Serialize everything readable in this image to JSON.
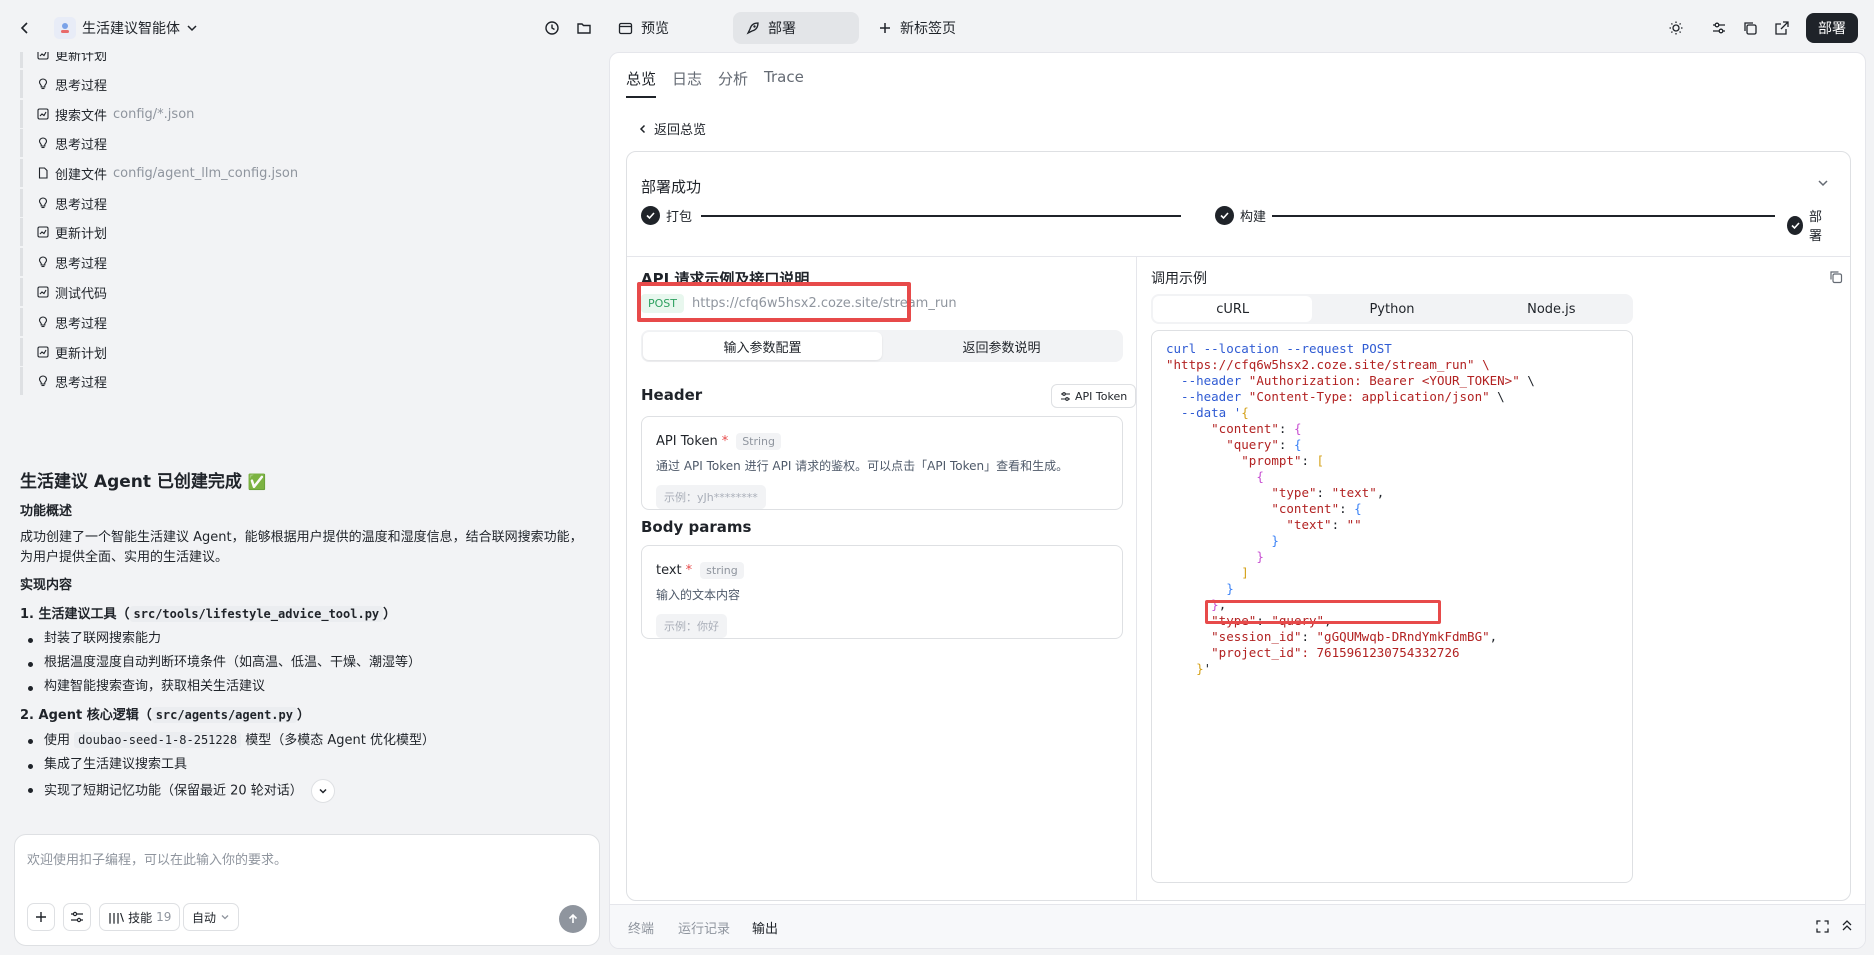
{
  "topbar": {
    "project_name": "生活建议智能体",
    "tab_preview": "预览",
    "tab_deploy": "部署",
    "tab_new": "新标签页",
    "deploy_button": "部署"
  },
  "left": {
    "steps": [
      {
        "label": "更新计划",
        "sub": "",
        "icon": "plan-icon"
      },
      {
        "label": "思考过程",
        "sub": "",
        "icon": "bulb-icon"
      },
      {
        "label": "搜索文件",
        "sub": "config/*.json",
        "icon": "plan-icon"
      },
      {
        "label": "思考过程",
        "sub": "",
        "icon": "bulb-icon"
      },
      {
        "label": "创建文件",
        "sub": "config/agent_llm_config.json",
        "icon": "file-icon"
      },
      {
        "label": "思考过程",
        "sub": "",
        "icon": "bulb-icon"
      },
      {
        "label": "更新计划",
        "sub": "",
        "icon": "plan-icon"
      },
      {
        "label": "思考过程",
        "sub": "",
        "icon": "bulb-icon"
      },
      {
        "label": "测试代码",
        "sub": "",
        "icon": "plan-icon"
      },
      {
        "label": "思考过程",
        "sub": "",
        "icon": "bulb-icon"
      },
      {
        "label": "更新计划",
        "sub": "",
        "icon": "plan-icon"
      },
      {
        "label": "思考过程",
        "sub": "",
        "icon": "bulb-icon"
      }
    ],
    "heading": "生活建议 Agent 已创建完成",
    "heading_emoji": "✅",
    "overview_title": "功能概述",
    "overview_text": "成功创建了一个智能生活建议 Agent，能够根据用户提供的温度和湿度信息，结合联网搜索功能，为用户提供全面、实用的生活建议。",
    "impl_title": "实现内容",
    "item1_title": "1. 生活建议工具（",
    "item1_code": "src/tools/lifestyle_advice_tool.py",
    "item1_close": "）",
    "item1_bullets": [
      "封装了联网搜索能力",
      "根据温度湿度自动判断环境条件（如高温、低温、干燥、潮湿等）",
      "构建智能搜索查询，获取相关生活建议"
    ],
    "item2_title": "2. Agent 核心逻辑（",
    "item2_code": "src/agents/agent.py",
    "item2_close": "）",
    "item2_b1_pre": "使用 ",
    "item2_b1_code": "doubao-seed-1-8-251228",
    "item2_b1_post": " 模型（多模态 Agent 优化模型）",
    "item2_b2": "集成了生活建议搜索工具",
    "item2_b3": "实现了短期记忆功能（保留最近 20 轮对话）",
    "chat_placeholder": "欢迎使用扣子编程，可以在此输入你的要求。",
    "skill_label": "技能",
    "skill_count": "19",
    "mode_label": "自动"
  },
  "right": {
    "tabs": [
      "总览",
      "日志",
      "分析",
      "Trace"
    ],
    "back_label": "返回总览",
    "deploy_status": "部署成功",
    "progress_steps": [
      "打包",
      "构建",
      "部署"
    ],
    "api_title": "API 请求示例及接口说明",
    "method": "POST",
    "endpoint": "https://cfq6w5hsx2.coze.site/stream_run",
    "seg_input": "输入参数配置",
    "seg_output": "返回参数说明",
    "header_title": "Header",
    "token_button": "API Token",
    "param1": {
      "name": "API Token",
      "type": "String",
      "desc": "通过 API Token 进行 API 请求的鉴权。可以点击「API Token」查看和生成。",
      "example": "示例：yJh********"
    },
    "body_title": "Body params",
    "param2": {
      "name": "text",
      "type": "string",
      "desc": "输入的文本内容",
      "example": "示例：你好"
    },
    "call_title": "调用示例",
    "langs": [
      "cURL",
      "Python",
      "Node.js"
    ],
    "code": {
      "l1": "curl --location --request POST",
      "l2": "\"https://cfq6w5hsx2.coze.site/stream_run\" \\",
      "l3a": "  --header ",
      "l3b": "\"Authorization: Bearer <YOUR_TOKEN>\"",
      "l3c": " \\",
      "l4a": "  --header ",
      "l4b": "\"Content-Type: application/json\"",
      "l4c": " \\",
      "l5": "  --data '",
      "project_id_line": "\"project_id\": 7615961230754332726"
    },
    "bottom_tabs": [
      "终端",
      "运行记录",
      "输出"
    ]
  }
}
